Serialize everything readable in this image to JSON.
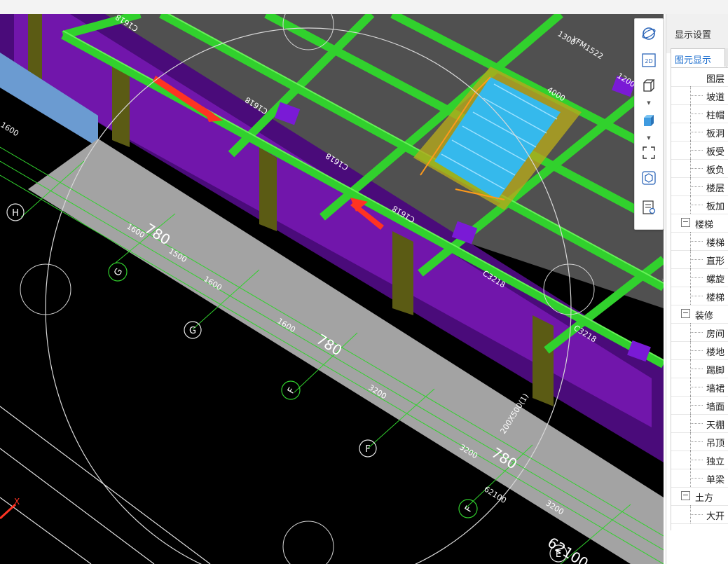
{
  "panel": {
    "title": "显示设置",
    "tabs": [
      {
        "label": "图元显示"
      }
    ],
    "tree": {
      "header": "图层",
      "rows": [
        {
          "type": "child",
          "label": "坡道"
        },
        {
          "type": "child",
          "label": "柱帽"
        },
        {
          "type": "child",
          "label": "板洞"
        },
        {
          "type": "child",
          "label": "板受"
        },
        {
          "type": "child",
          "label": "板负"
        },
        {
          "type": "child",
          "label": "楼层"
        },
        {
          "type": "child",
          "label": "板加"
        },
        {
          "type": "group",
          "label": "楼梯"
        },
        {
          "type": "child",
          "label": "楼梯"
        },
        {
          "type": "child",
          "label": "直形"
        },
        {
          "type": "child",
          "label": "螺旋"
        },
        {
          "type": "child",
          "label": "楼梯"
        },
        {
          "type": "group",
          "label": "装修"
        },
        {
          "type": "child",
          "label": "房间"
        },
        {
          "type": "child",
          "label": "楼地"
        },
        {
          "type": "child",
          "label": "踢脚"
        },
        {
          "type": "child",
          "label": "墙裙"
        },
        {
          "type": "child",
          "label": "墙面"
        },
        {
          "type": "child",
          "label": "天棚"
        },
        {
          "type": "child",
          "label": "吊顶"
        },
        {
          "type": "child",
          "label": "独立"
        },
        {
          "type": "child",
          "label": "单梁"
        },
        {
          "type": "group",
          "label": "土方"
        },
        {
          "type": "child",
          "label": "大开"
        }
      ]
    }
  },
  "toolbar": {
    "buttons": [
      {
        "name": "orbit-icon",
        "label": ""
      },
      {
        "name": "view-2d-icon",
        "label": "2D"
      },
      {
        "name": "cube-view-icon",
        "label": ""
      },
      {
        "name": "shaded-cube-icon",
        "label": ""
      },
      {
        "name": "fit-window-icon",
        "label": ""
      },
      {
        "name": "dynamic-observe-icon",
        "label": ""
      },
      {
        "name": "display-settings-icon",
        "label": ""
      }
    ]
  },
  "viewport": {
    "axis_labels": [
      "H",
      "G",
      "G",
      "F",
      "F",
      "F",
      "E"
    ],
    "dims": [
      "1600",
      "1500",
      "1600",
      "1600",
      "3200",
      "3200",
      "3200",
      "4000",
      "1300",
      "1200",
      "780",
      "780",
      "780",
      "62100",
      "62100",
      "1600"
    ],
    "beams": [
      "C1618",
      "C1618",
      "C1618",
      "C1618",
      "C3218",
      "C3218"
    ],
    "door": "YFM1522",
    "note": "200X500(1)"
  },
  "colors": {
    "viewport_bg": "#000000",
    "slab": "#9a9a9a",
    "beam": "#31d12d",
    "wall": "#6b0f9e",
    "stair": "#35b9ec",
    "accent": "#1e6fcf"
  }
}
